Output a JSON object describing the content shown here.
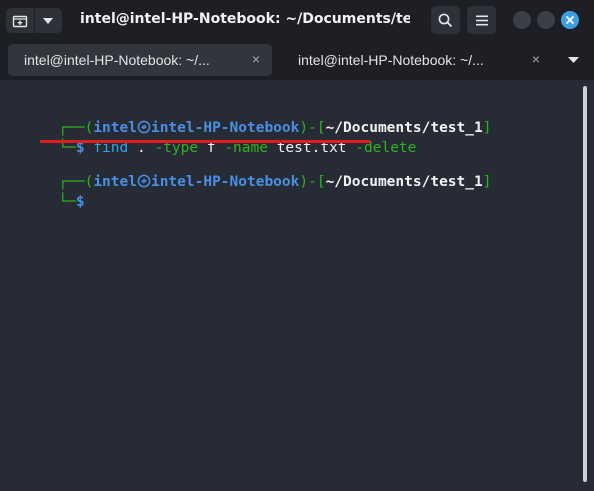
{
  "window": {
    "title": "intel@intel-HP-Notebook: ~/Documents/tes..."
  },
  "titlebar": {
    "icons": [
      "new-tab-icon",
      "chevron-down-icon",
      "search-icon",
      "hamburger-menu-icon",
      "minimize-icon",
      "maximize-icon",
      "close-icon"
    ]
  },
  "tabs": [
    {
      "label": "intel@intel-HP-Notebook: ~/...",
      "close": "×"
    },
    {
      "label": "intel@intel-HP-Notebook: ~/...",
      "close": "×"
    }
  ],
  "terminal": {
    "prompt1": {
      "corner": "┌──(",
      "user": "intel",
      "host": "intel-HP-Notebook",
      "mid": ")-[",
      "path": "~/Documents/test_1",
      "end": "]"
    },
    "cmd1": {
      "corner": "└─",
      "dollar": "$",
      "program": "find",
      "dot": ".",
      "opt1": "-type",
      "arg1": "f",
      "opt2": "-name",
      "arg2": "test.txt",
      "opt3": "-delete"
    },
    "prompt2": {
      "corner": "┌──(",
      "user": "intel",
      "host": "intel-HP-Notebook",
      "mid": ")-[",
      "path": "~/Documents/test_1",
      "end": "]"
    },
    "cmd2": {
      "corner": "└─",
      "dollar": "$"
    }
  },
  "colors": {
    "background": "#262b36",
    "prompt_green": "#2fb31c",
    "prompt_blue": "#4a8fe0",
    "command_cyan": "#2ba7e5",
    "highlight_red": "#e31b1b"
  }
}
